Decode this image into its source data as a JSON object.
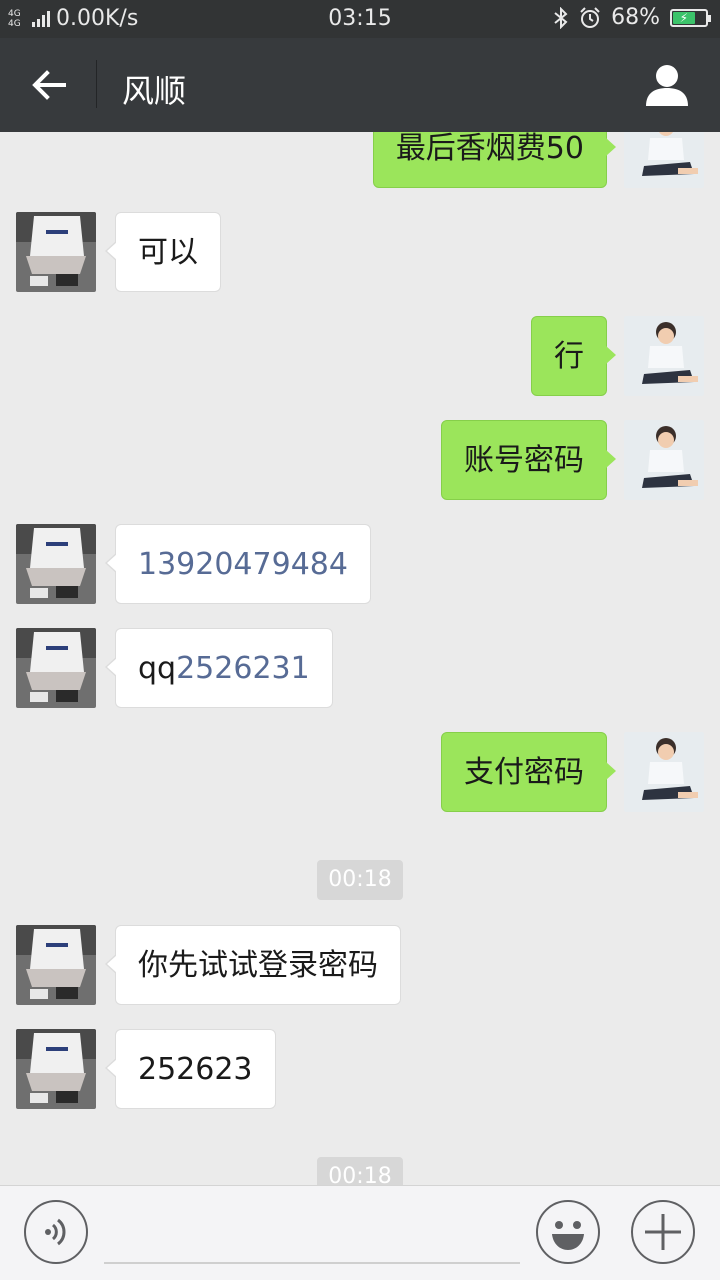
{
  "status_bar": {
    "network_label": "4G 4G",
    "speed": "0.00K/s",
    "time": "03:15",
    "battery": "68%",
    "battery_level": 0.68
  },
  "header": {
    "title": "风顺"
  },
  "messages": [
    {
      "side": "out",
      "text": "最后香烟费50"
    },
    {
      "side": "in",
      "text": "可以"
    },
    {
      "side": "out",
      "text": "行"
    },
    {
      "side": "out",
      "text": "账号密码"
    },
    {
      "side": "in",
      "text": "13920479484",
      "link": true
    },
    {
      "side": "in",
      "prefix": "qq",
      "link_text": "2526231"
    },
    {
      "side": "out",
      "text": "支付密码"
    },
    {
      "type": "time",
      "text": "00:18"
    },
    {
      "side": "in",
      "text": "你先试试登录密码"
    },
    {
      "side": "in",
      "text": "252623"
    },
    {
      "type": "time",
      "text": "00:18"
    }
  ],
  "icons": {
    "back": "arrow-left-icon",
    "profile": "person-icon",
    "voice": "voice-icon",
    "emoji": "smiley-icon",
    "more": "plus-icon"
  },
  "colors": {
    "outgoing_bubble": "#9be55b",
    "incoming_bubble": "#ffffff",
    "link": "#576b95",
    "header": "#373a3d"
  }
}
